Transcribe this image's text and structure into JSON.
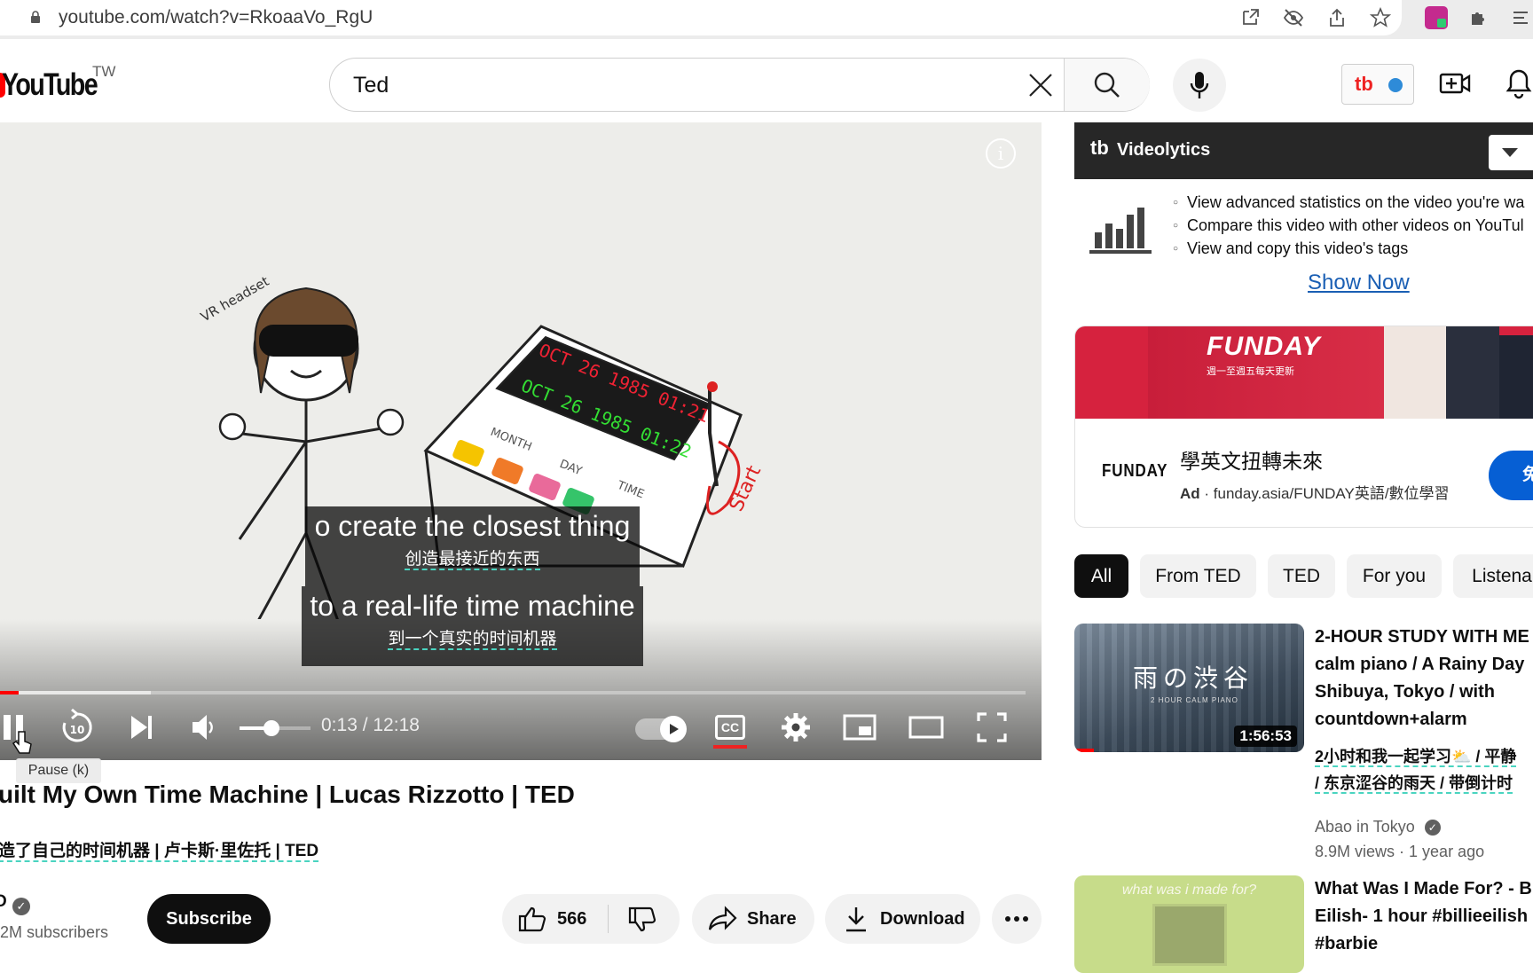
{
  "browser": {
    "url": "youtube.com/watch?v=RkoaaVo_RgU",
    "icons": [
      "open-external-icon",
      "eye-off-icon",
      "share-icon",
      "star-icon",
      "extension-translate-icon",
      "puzzle-icon",
      "reading-list-icon"
    ]
  },
  "header": {
    "logo": "YouTube",
    "region": "TW",
    "search_value": "Ted",
    "icons": [
      "clear-icon",
      "search-icon",
      "mic-icon",
      "create-icon",
      "bell-icon"
    ]
  },
  "player": {
    "subtitles": {
      "line1_en": "o create the closest thing",
      "line1_zh": "创造最接近的东西",
      "line2_en": "to a real-life time machine",
      "line2_zh": "到一个真实的时间机器"
    },
    "drawing_text": {
      "vr": "VR headset",
      "date1": "OCT 26 1985 01:21",
      "date2": "OCT 26 1985 01:22",
      "month": "MONTH",
      "day": "DAY",
      "time": "TIME",
      "start": "Start"
    },
    "time": "0:13 / 12:18",
    "progress": 0.018,
    "buffered": 0.147,
    "volume": 0.45,
    "tooltip": "Pause (k)"
  },
  "video": {
    "title": "uilt My Own Time Machine | Lucas Rizzotto | TED",
    "title_zh": "造了自己的时间机器 | 卢卡斯·里佐托 | TED",
    "channel": "D",
    "subscribers": "2M subscribers",
    "subscribe_label": "Subscribe",
    "likes": "566",
    "share_label": "Share",
    "download_label": "Download"
  },
  "videolytics": {
    "title": "Videolytics",
    "items": [
      "View advanced statistics on the video you're wa",
      "Compare this video with other videos on YouTul",
      "View and copy this video's tags"
    ],
    "show_now": "Show Now"
  },
  "ad": {
    "banner_word": "FUNDAY",
    "banner_sub": "週一至週五每天更新",
    "logo": "FUNDAY",
    "title": "學英文扭轉未來",
    "ad_label": "Ad",
    "domain": "funday.asia/FUNDAY英語/數位學習",
    "cta": "免"
  },
  "chips": [
    "All",
    "From TED",
    "TED",
    "For you",
    "Listena"
  ],
  "recommendations": [
    {
      "title_lines": [
        "2-HOUR STUDY WITH ME",
        "calm piano / A Rainy Day",
        "Shibuya, Tokyo / with",
        "countdown+alarm"
      ],
      "title_zh_lines": [
        "2小时和我一起学习⛅ / 平静",
        "/ 东京涩谷的雨天 / 带倒计时"
      ],
      "thumb_text": "雨の渋谷",
      "thumb_sub": "2 HOUR CALM PIANO",
      "duration": "1:56:53",
      "channel": "Abao in Tokyo",
      "views": "8.9M views",
      "age": "1 year ago"
    },
    {
      "title_lines": [
        "What Was I Made For? - B",
        "Eilish- 1 hour #billieeilish",
        "#barbie"
      ],
      "thumb_text": "what was i made for?"
    }
  ]
}
